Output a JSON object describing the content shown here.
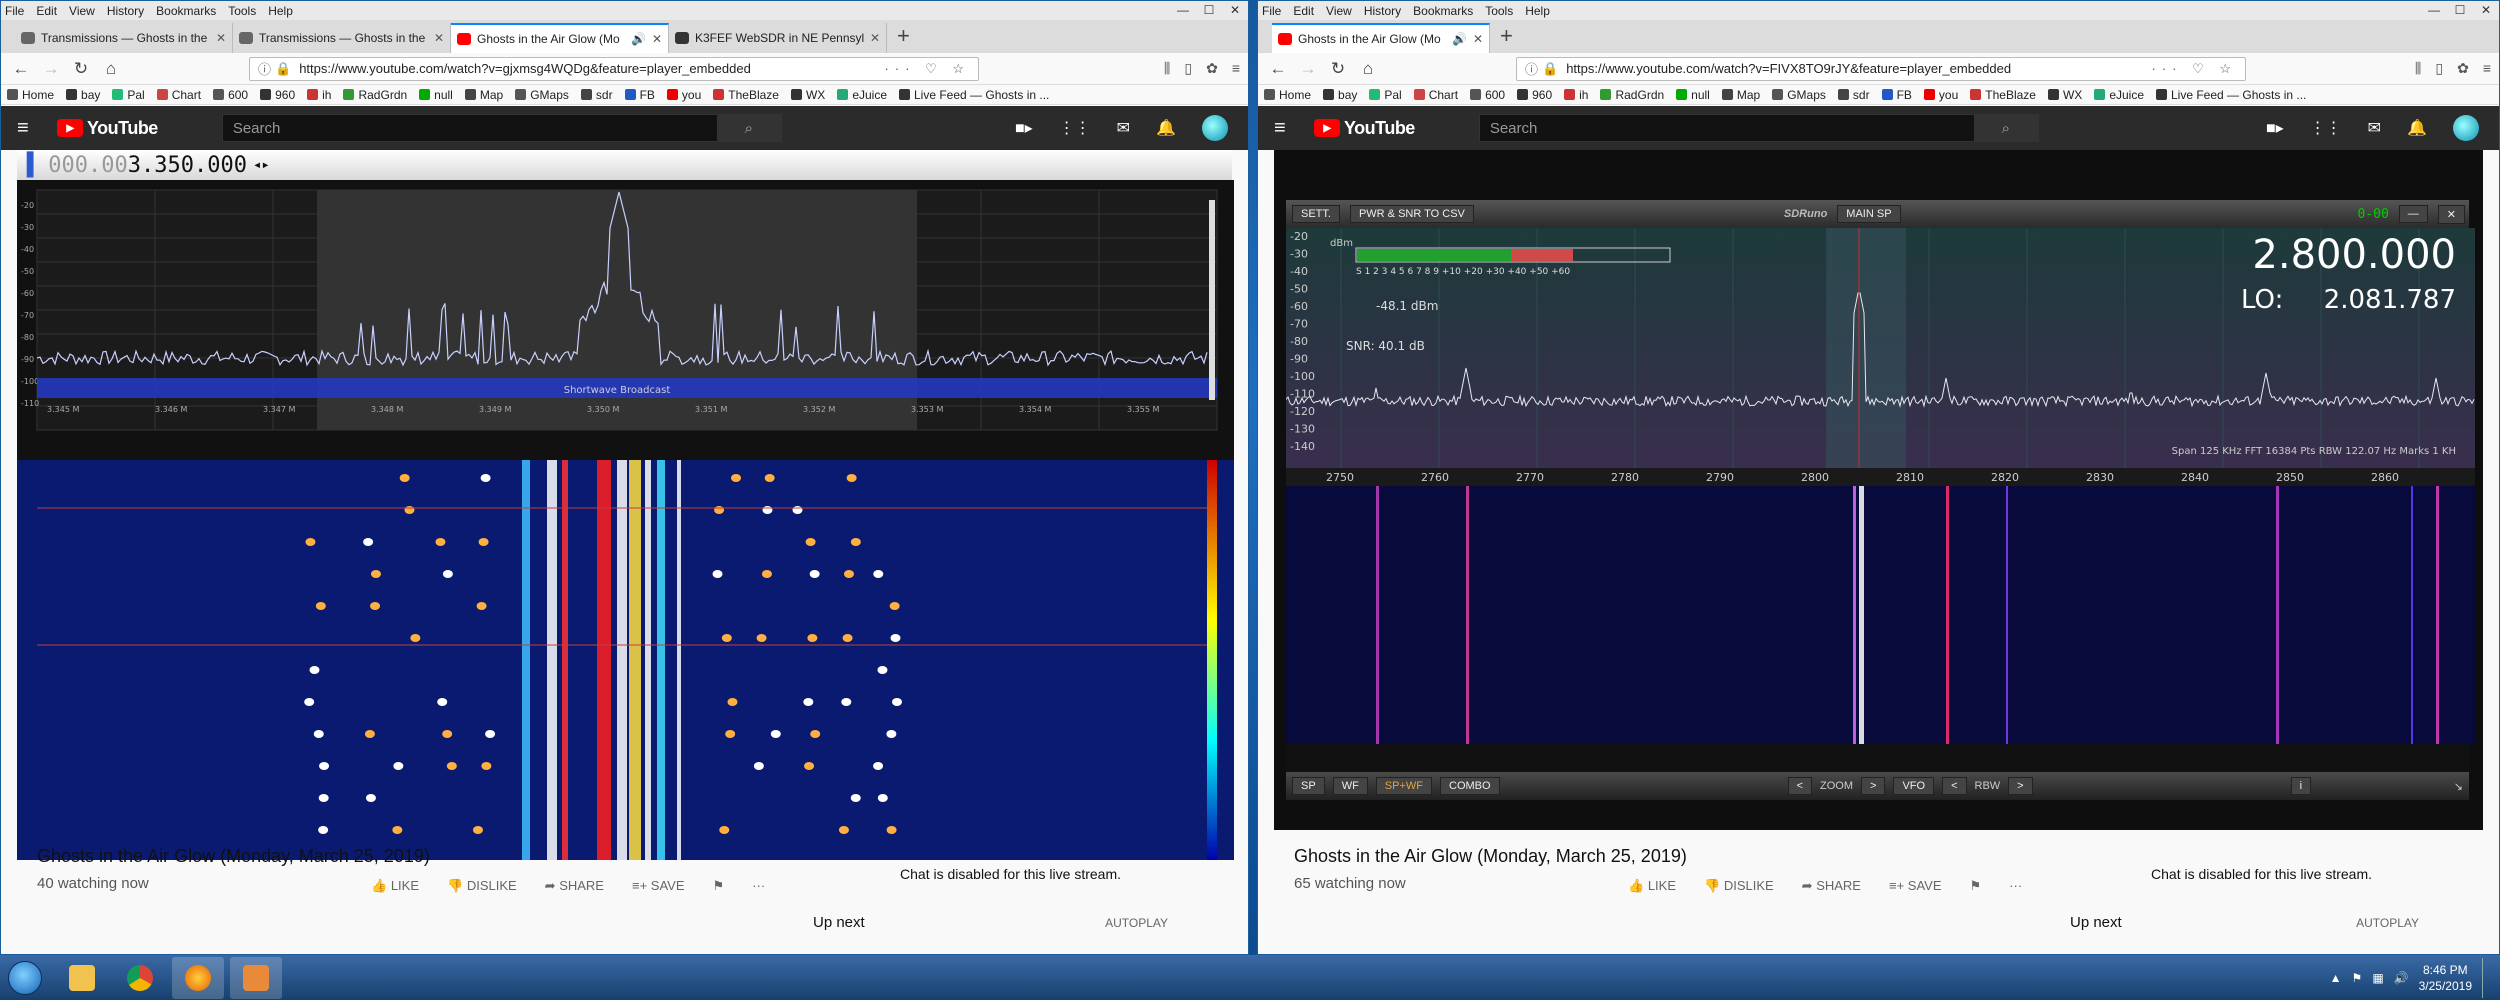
{
  "left": {
    "menu": [
      "File",
      "Edit",
      "View",
      "History",
      "Bookmarks",
      "Tools",
      "Help"
    ],
    "tabs": [
      {
        "title": "Transmissions — Ghosts in the",
        "active": false
      },
      {
        "title": "Transmissions — Ghosts in the",
        "active": false
      },
      {
        "title": "Ghosts in the Air Glow (Mo",
        "active": true
      },
      {
        "title": "K3FEF WebSDR in NE Pennsylv",
        "active": false
      }
    ],
    "url": "https://www.youtube.com/watch?v=gjxmsg4WQDg&feature=player_embedded",
    "frequency_prefix": "000.00",
    "frequency": "3.350.000",
    "band_label": "Shortwave Broadcast",
    "ticks": [
      "3.345 M",
      "3.346 M",
      "3.347 M",
      "3.348 M",
      "3.349 M",
      "3.350 M",
      "3.351 M",
      "3.352 M",
      "3.353 M",
      "3.354 M",
      "3.355 M"
    ],
    "db_ticks": [
      "-20",
      "-30",
      "-40",
      "-50",
      "-60",
      "-70",
      "-80",
      "-90",
      "-100",
      "-110"
    ],
    "video_title": "Ghosts in the Air Glow (Monday, March 25, 2019)",
    "viewers": "40 watching now",
    "actions": [
      "LIKE",
      "DISLIKE",
      "SHARE",
      "SAVE"
    ],
    "chat": "Chat is disabled for this live stream.",
    "up_next": "Up next",
    "autoplay": "AUTOPLAY"
  },
  "right": {
    "menu": [
      "File",
      "Edit",
      "View",
      "History",
      "Bookmarks",
      "Tools",
      "Help"
    ],
    "tabs": [
      {
        "title": "Ghosts in the Air Glow (Mo",
        "active": true
      }
    ],
    "url": "https://www.youtube.com/watch?v=FIVX8TO9rJY&feature=player_embedded",
    "sdr_buttons": [
      "SETT.",
      "PWR & SNR TO CSV"
    ],
    "sdr_brand": "SDRuno",
    "sdr_mode": "MAIN SP",
    "sdr_counter": "0-00",
    "freq": "2.800.000",
    "lo_label": "LO:",
    "lo": "2.081.787",
    "dbm_label": "dBm",
    "s_scale": "S  1  2  3  4  5  6  7  8  9  +10 +20 +30 +40 +50 +60",
    "power": "-48.1 dBm",
    "snr": "SNR: 40.1 dB",
    "span": "Span 125 KHz  FFT 16384 Pts  RBW 122.07 Hz  Marks 1 KH",
    "db_ticks": [
      "-20",
      "-30",
      "-40",
      "-50",
      "-60",
      "-70",
      "-80",
      "-90",
      "-100",
      "-110",
      "-120",
      "-130",
      "-140"
    ],
    "ticks": [
      "2750",
      "2760",
      "2770",
      "2780",
      "2790",
      "2800",
      "2810",
      "2820",
      "2830",
      "2840",
      "2850",
      "2860"
    ],
    "bottom_buttons": [
      "SP",
      "WF",
      "SP+WF",
      "COMBO"
    ],
    "zoom": "ZOOM",
    "vfo": "VFO",
    "rbw": "RBW",
    "video_title": "Ghosts in the Air Glow (Monday, March 25, 2019)",
    "viewers": "65 watching now",
    "actions": [
      "LIKE",
      "DISLIKE",
      "SHARE",
      "SAVE"
    ],
    "chat": "Chat is disabled for this live stream.",
    "up_next": "Up next",
    "autoplay": "AUTOPLAY"
  },
  "bookmarks": [
    "Home",
    "bay",
    "Pal",
    "Chart",
    "600",
    "960",
    "ih",
    "RadGrdn",
    "null",
    "Map",
    "GMaps",
    "sdr",
    "FB",
    "you",
    "TheBlaze",
    "WX",
    "eJuice",
    "Live Feed — Ghosts in ..."
  ],
  "youtube": {
    "logo": "YouTube",
    "search_placeholder": "Search"
  },
  "taskbar": {
    "time": "8:46 PM",
    "date": "3/25/2019"
  },
  "colors": {
    "accent": "#0a84ff",
    "yt_red": "#ff0000",
    "spectrum_bg": "#111111",
    "waterfall_bg": "#081a66"
  }
}
